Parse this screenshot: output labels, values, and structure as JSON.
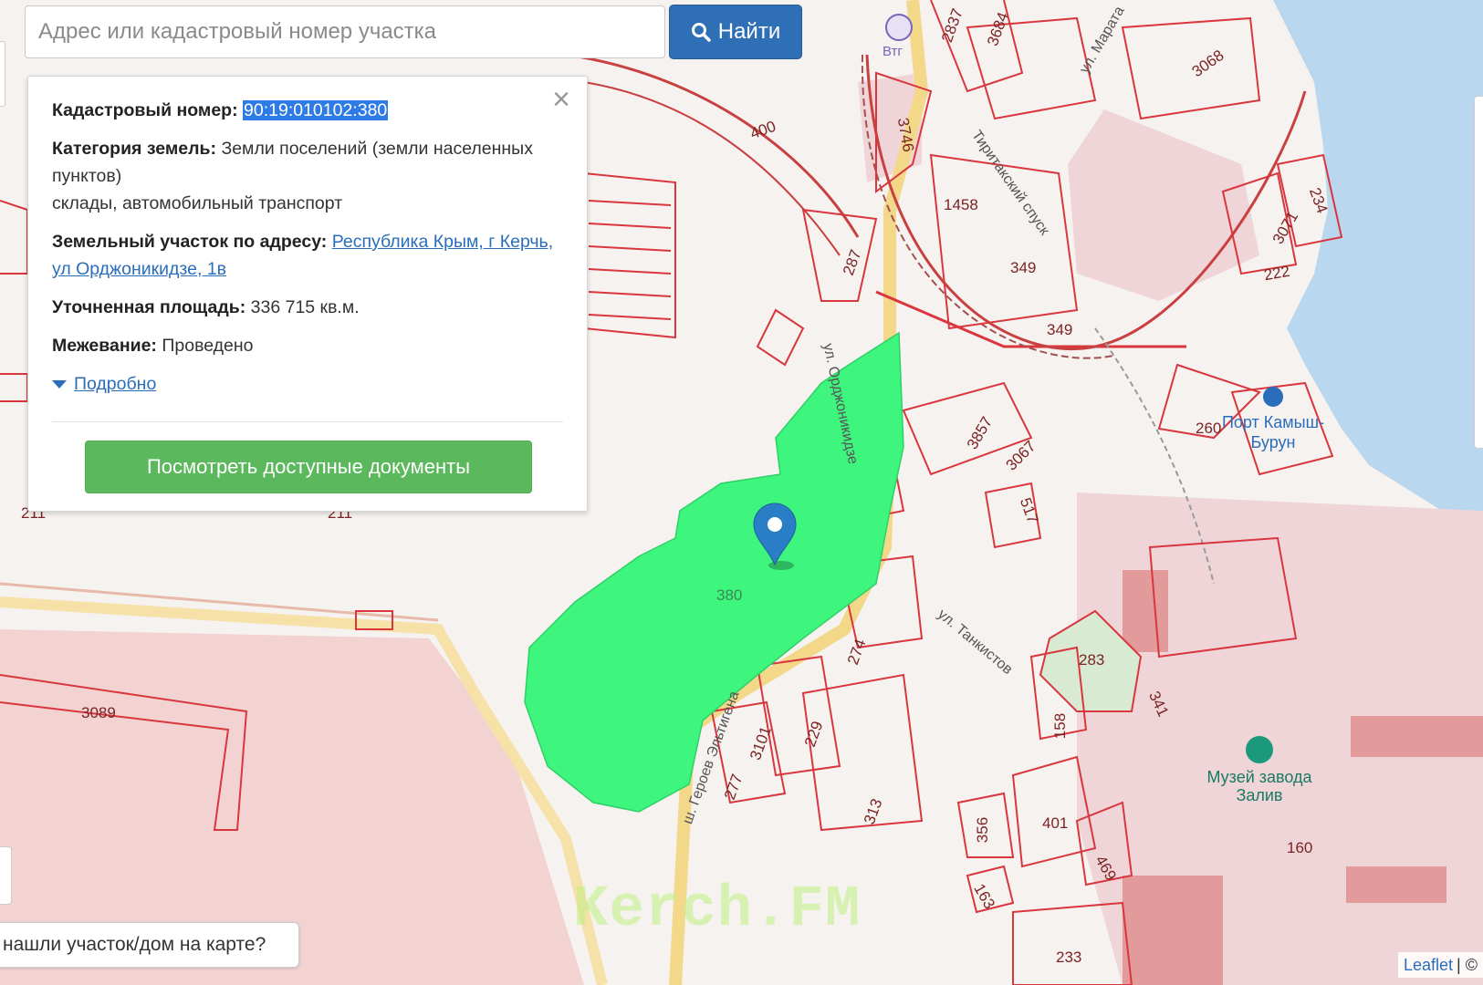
{
  "search": {
    "placeholder": "Адрес или кадастровый номер участка",
    "value": "",
    "button_label": "Найти",
    "button_icon": "search-icon"
  },
  "popup": {
    "cadastral_label": "Кадастровый номер:",
    "cadastral_value": "90:19:010102:380",
    "category_label": "Категория земель:",
    "category_value": "Земли поселений (земли населенных пунктов)",
    "usage": "склады, автомобильный транспорт",
    "address_label": "Земельный участок по адресу:",
    "address_link": "Республика Крым, г Керчь, ул Орджоникидзе, 1в",
    "area_label": "Уточненная площадь:",
    "area_value": "336 715 кв.м.",
    "survey_label": "Межевание:",
    "survey_value": "Проведено",
    "more_label": "Подробно",
    "docs_button": "Посмотреть доступные документы",
    "close_icon": "close-icon"
  },
  "map": {
    "selected_parcel_label": "380",
    "parcel_labels": [
      "2837",
      "3684",
      "3068",
      "400",
      "3746",
      "1458",
      "349",
      "349",
      "3071",
      "234",
      "222",
      "287",
      "260",
      "3857",
      "3067",
      "517",
      "274",
      "283",
      "341",
      "158",
      "3101",
      "229",
      "277",
      "313",
      "401",
      "356",
      "469",
      "163",
      "160",
      "233",
      "3089",
      "211",
      "211"
    ],
    "street_labels": [
      "ул. Орджоникидзе",
      "Тиритакский спуск",
      "ул. Танкистов",
      "ш. Героев Эльтигена",
      "ул. Марата"
    ],
    "poi_labels": [
      "Порт Камыш-Бурун",
      "Музей завода Залив",
      "Втг"
    ],
    "colors": {
      "parcel_border": "#d9363e",
      "selected_parcel": "#3ef57e",
      "water": "#b9d7ee",
      "industrial": "#f0cfcf",
      "road": "#f3d88a",
      "marker": "#2a7ec6"
    }
  },
  "help_text": "нашли участок/дом на карте?",
  "attribution": {
    "leaflet": "Leaflet",
    "separator": "| ©"
  },
  "watermark": "Kerch.FM"
}
